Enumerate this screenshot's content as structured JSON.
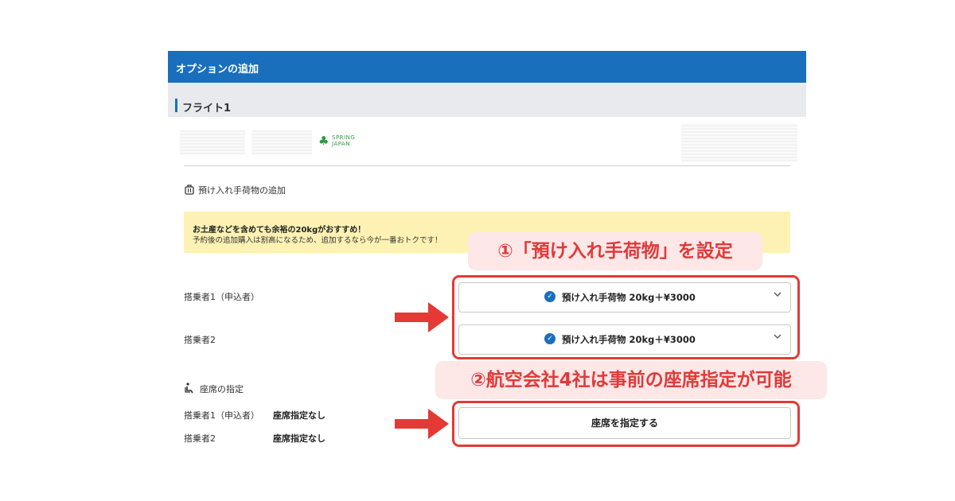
{
  "header": {
    "title": "オプションの追加"
  },
  "flight": {
    "title": "フライト1"
  },
  "airline": {
    "logo_line1": "SPRING",
    "logo_line2": "JAPAN",
    "logo_icon": "spring-japan-leaf-icon",
    "brand_color": "#2e9b3e"
  },
  "baggage": {
    "icon": "luggage-icon",
    "title": "預け入れ手荷物の追加",
    "notice_bold": "お土産などを含めても余裕の20kgがおすすめ！",
    "notice_text": "予約後の追加購入は割高になるため、追加するなら今が一番おトクです！",
    "passengers": [
      {
        "label": "搭乗者1（申込者）",
        "selected": "預け入れ手荷物 20kg＋¥3000"
      },
      {
        "label": "搭乗者2",
        "selected": "預け入れ手荷物 20kg＋¥3000"
      }
    ]
  },
  "seat": {
    "icon": "seat-icon",
    "title": "座席の指定",
    "passengers": [
      {
        "label": "搭乗者1（申込者）",
        "value": "座席指定なし"
      },
      {
        "label": "搭乗者2",
        "value": "座席指定なし"
      }
    ],
    "button_label": "座席を指定する"
  },
  "annotations": {
    "callout1": "①「預け入れ手荷物」を設定",
    "callout2": "②航空会社4社は事前の座席指定が可能",
    "highlight_color": "#e53935"
  },
  "colors": {
    "accent": "#1a6fbd",
    "notice_bg": "#fdf2b3",
    "callout_bg": "#fde7e7"
  }
}
